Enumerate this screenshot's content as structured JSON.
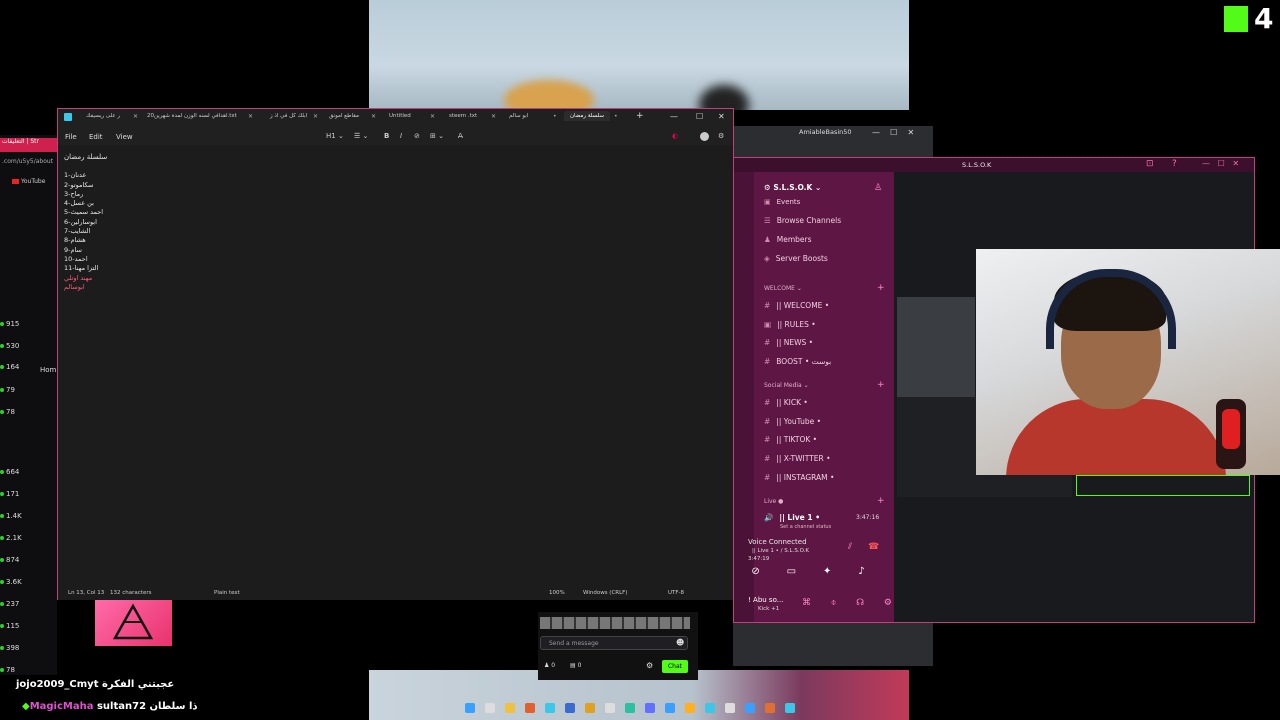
{
  "stream": {
    "kick_number": "4"
  },
  "left_browser": {
    "tab": "التعليقات | Str",
    "url": ".com/u5y5/about",
    "yt": "YouTube",
    "stats": [
      "915",
      "530",
      "164",
      "79",
      "78",
      "664",
      "171",
      "1.4K",
      "2.1K",
      "874",
      "3.6K",
      "237",
      "115",
      "398",
      "78"
    ],
    "home": "Hom"
  },
  "notepad": {
    "tabs": [
      "ر على ريسيفك",
      "20اهدافي لسنه الوزن لمدة شهرين.txt",
      "ابلك كل في اذ ز",
      "مقاطع امونق",
      "Untitled",
      "steem .txt",
      "ابو سالم",
      "سلسلة رمضان"
    ],
    "new_tab": "+",
    "menu": {
      "file": "File",
      "edit": "Edit",
      "view": "View"
    },
    "toolbar": {
      "heading": "H1 ⌄",
      "list": "☰ ⌄",
      "bold": "B",
      "italic": "I",
      "link": "⊘",
      "table": "⊞ ⌄",
      "clear": "A̶"
    },
    "title_line": "سلسلة رمضان",
    "lines": [
      "1-عدنان",
      "2-سكاموتو",
      "3-رماح",
      "4-بن عسل",
      "5-احمد سميث",
      "6-ابوسارلين",
      "7-الشايب",
      "8-هشام",
      "9-سام",
      "10-احمد",
      "11-التزا مهنا",
      "مهند اوتلي",
      "ابوسالم"
    ],
    "status": {
      "pos": "Ln 13, Col 13",
      "chars": "132 characters",
      "format": "Plain text",
      "zoom": "100%",
      "eol": "Windows (CRLF)",
      "enc": "UTF-8"
    }
  },
  "chat": {
    "placeholder": "Send a message",
    "btn": "Chat",
    "count1": "0",
    "count2": "0"
  },
  "discord": {
    "window_title": "S.L.S.O.K",
    "account": "AmiableBasin50",
    "server": "S.L.S.O.K",
    "top_items": [
      "Events",
      "Browse Channels",
      "Members",
      "Server Boosts"
    ],
    "cat_welcome": "WELCOME",
    "welcome_channels": [
      "|| WELCOME •",
      "|| RULES •",
      "|| NEWS •",
      "BOOST • بوست"
    ],
    "cat_social": "Social Media",
    "social_channels": [
      "|| KICK •",
      "|| YouTube •",
      "|| TIKTOK •",
      "|| X-TWITTER •",
      "|| INSTAGRAM •"
    ],
    "cat_live": "Live",
    "live_channel": "|| Live 1 •",
    "live_time": "3:47:16",
    "live_sub": "Set a channel status",
    "voice_connected": "Voice Connected",
    "voice_sub": "|| Live 1 • / S.L.S.O.K",
    "voice_time": "3:47:19",
    "user": "! Abu so...",
    "user_sub": "Kick +1"
  },
  "overlay": {
    "line1_user": "jojo2009_Cmyt",
    "line1_msg": "عجبتني الفكرة",
    "line2_user": "MagicMaha",
    "line2_msg": "sultan72 ذا سلطان"
  }
}
